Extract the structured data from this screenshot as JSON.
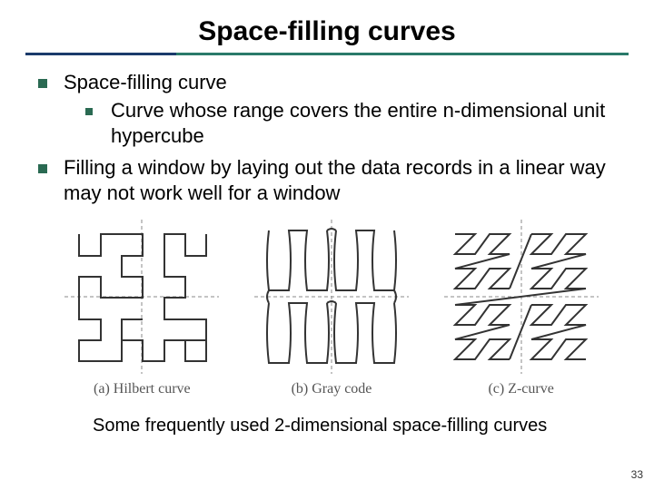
{
  "title": "Space-filling curves",
  "bullets": {
    "item1": "Space-filling curve",
    "item1_sub1": "Curve whose range covers the entire n-dimensional unit hypercube",
    "item2": "Filling a window by laying out the data records in a linear way may not work well for a window"
  },
  "figure": {
    "panel_a": "(a) Hilbert curve",
    "panel_b": "(b) Gray code",
    "panel_c": "(c) Z-curve",
    "caption": "Some frequently used 2-dimensional space-filling curves"
  },
  "page_number": "33"
}
